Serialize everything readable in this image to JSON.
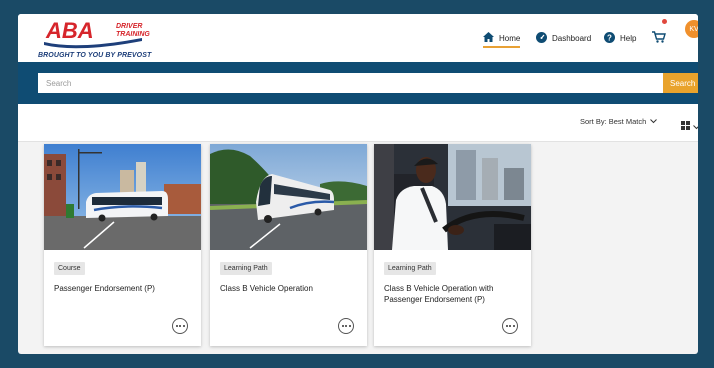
{
  "header": {
    "logo": {
      "brand": "ABA",
      "sub_line1": "DRIVER",
      "sub_line2": "TRAINING",
      "tagline": "BROUGHT TO YOU BY PREVOST"
    },
    "nav": [
      {
        "label": "Home",
        "icon": "home-icon"
      },
      {
        "label": "Dashboard",
        "icon": "dashboard-icon"
      },
      {
        "label": "Help",
        "icon": "help-icon"
      }
    ],
    "cart_icon": "cart-icon",
    "avatar_initials": "KV"
  },
  "search": {
    "placeholder": "Search",
    "button_label": "Search"
  },
  "sort": {
    "label": "Sort By: Best Match"
  },
  "colors": {
    "brand_blue": "#0f4c73",
    "accent_orange": "#e9a32c",
    "logo_red": "#d6252b",
    "logo_navy": "#1e3f7a"
  },
  "cards": [
    {
      "badge": "Course",
      "title": "Passenger Endorsement (P)",
      "image": "coach bus on city street"
    },
    {
      "badge": "Learning Path",
      "title": "Class B Vehicle Operation",
      "image": "coach bus on highway"
    },
    {
      "badge": "Learning Path",
      "title": "Class B Vehicle Operation with Passenger Endorsement (P)",
      "image": "driver at steering wheel"
    }
  ]
}
